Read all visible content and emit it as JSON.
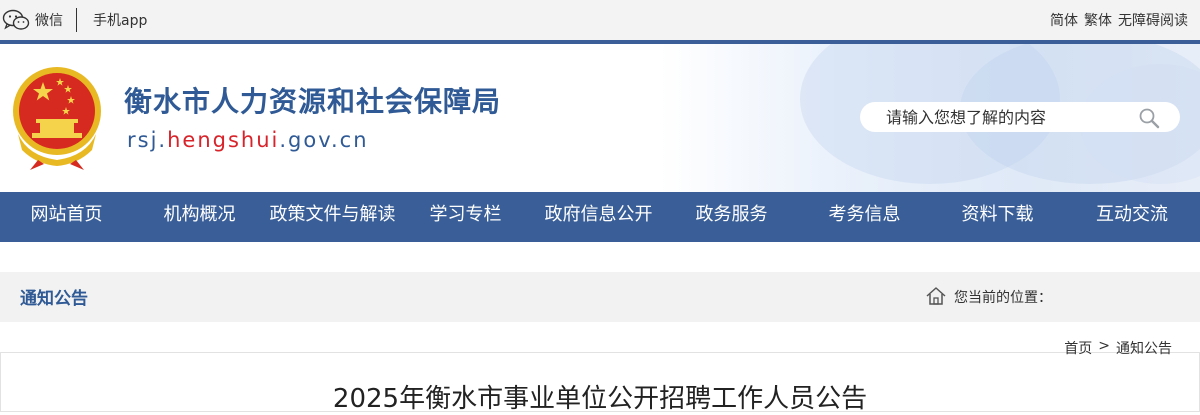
{
  "topbar": {
    "wechat_label": "微信",
    "app_label": "手机app",
    "lang_simplified": "简体",
    "lang_traditional": "繁体",
    "accessibility": "无障碍阅读"
  },
  "header": {
    "site_title": "衡水市人力资源和社会保障局",
    "url_prefix": "rsj.",
    "url_highlight": "hengshui",
    "url_suffix": ".gov.cn",
    "search_placeholder": "请输入您想了解的内容"
  },
  "nav": {
    "items": [
      "网站首页",
      "机构概况",
      "政策文件与解读",
      "学习专栏",
      "政府信息公开",
      "政务服务",
      "考务信息",
      "资料下载",
      "互动交流"
    ]
  },
  "location": {
    "section_title": "通知公告",
    "label": "您当前的位置："
  },
  "breadcrumb": {
    "home": "首页",
    "separator": ">",
    "current": "通知公告"
  },
  "article": {
    "title": "2025年衡水市事业单位公开招聘工作人员公告"
  },
  "colors": {
    "brand_blue": "#3a5f98",
    "title_blue": "#2f5a95",
    "url_red": "#d8232a"
  }
}
